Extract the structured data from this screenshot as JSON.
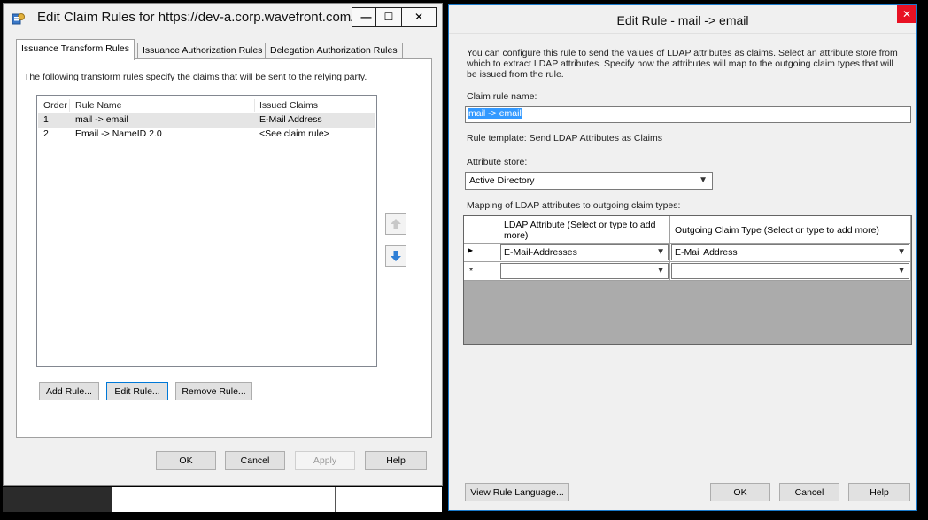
{
  "left_window": {
    "title": "Edit Claim Rules for https://dev-a.corp.wavefront.com/",
    "controls": {
      "minimize": "—",
      "maximize": "☐",
      "close": "✕"
    },
    "tabs": [
      {
        "label": "Issuance Transform Rules",
        "active": true
      },
      {
        "label": "Issuance Authorization Rules",
        "active": false
      },
      {
        "label": "Delegation Authorization Rules",
        "active": false
      }
    ],
    "description": "The following transform rules specify the claims that will be sent to the relying party.",
    "list": {
      "headers": {
        "order": "Order",
        "rule_name": "Rule Name",
        "issued_claims": "Issued Claims"
      },
      "rows": [
        {
          "order": "1",
          "rule_name": "mail -> email",
          "issued_claims": "E-Mail Address"
        },
        {
          "order": "2",
          "rule_name": "Email -> NameID 2.0",
          "issued_claims": "<See claim rule>"
        }
      ]
    },
    "buttons": {
      "add_rule": "Add Rule...",
      "edit_rule": "Edit Rule...",
      "remove_rule": "Remove Rule...",
      "ok": "OK",
      "cancel": "Cancel",
      "apply": "Apply",
      "help": "Help"
    }
  },
  "right_window": {
    "title": "Edit Rule - mail -> email",
    "close": "✕",
    "description": "You can configure this rule to send the values of LDAP attributes as claims. Select an attribute store from which to extract LDAP attributes. Specify how the attributes will map to the outgoing claim types that will be issued from the rule.",
    "claim_rule_name_label": "Claim rule name:",
    "claim_rule_name_value": "mail -> email",
    "rule_template": "Rule template: Send LDAP Attributes as Claims",
    "attribute_store_label": "Attribute store:",
    "attribute_store_value": "Active Directory",
    "mapping_label": "Mapping of LDAP attributes to outgoing claim types:",
    "grid": {
      "header_ldap": "LDAP Attribute (Select or type to add more)",
      "header_outgoing": "Outgoing Claim Type (Select or type to add more)",
      "rows": [
        {
          "marker": "▶",
          "ldap": "E-Mail-Addresses",
          "outgoing": "E-Mail Address"
        },
        {
          "marker": "*",
          "ldap": "",
          "outgoing": ""
        }
      ]
    },
    "buttons": {
      "view_rule_language": "View Rule Language...",
      "ok": "OK",
      "cancel": "Cancel",
      "help": "Help"
    }
  }
}
